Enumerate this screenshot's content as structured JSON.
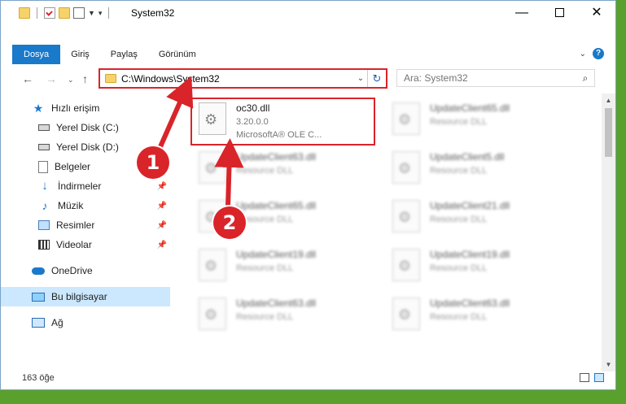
{
  "window": {
    "title": "System32",
    "controls": {
      "minimize": "—",
      "maximize": "",
      "close": "✕"
    }
  },
  "ribbon": {
    "tabs": [
      {
        "label": "Dosya",
        "active": true
      },
      {
        "label": "Giriş"
      },
      {
        "label": "Paylaş"
      },
      {
        "label": "Görünüm"
      }
    ],
    "help": "?"
  },
  "nav": {
    "back": "←",
    "forward": "→",
    "recent": "⌄",
    "up": "↑"
  },
  "address": {
    "path": "C:\\Windows\\System32"
  },
  "search": {
    "placeholder": "Ara: System32"
  },
  "sidebar": {
    "items": [
      {
        "label": "Hızlı erişim",
        "icon": "star-icon"
      },
      {
        "label": "Yerel Disk (C:)",
        "icon": "disk-icon"
      },
      {
        "label": "Yerel Disk (D:)",
        "icon": "disk-icon"
      },
      {
        "label": "Belgeler",
        "icon": "documents-icon"
      },
      {
        "label": "İndirmeler",
        "icon": "download-icon",
        "pinned": true
      },
      {
        "label": "Müzik",
        "icon": "music-icon",
        "pinned": true
      },
      {
        "label": "Resimler",
        "icon": "pictures-icon",
        "pinned": true
      },
      {
        "label": "Videolar",
        "icon": "video-icon",
        "pinned": true
      },
      {
        "label": "OneDrive",
        "icon": "cloud-icon"
      },
      {
        "label": "Bu bilgisayar",
        "icon": "computer-icon",
        "selected": true
      },
      {
        "label": "Ağ",
        "icon": "network-icon"
      }
    ]
  },
  "files": [
    {
      "name": "oc30.dll",
      "line2": "3.20.0.0",
      "line3": "MicrosoftA® OLE C...",
      "blurred": false
    },
    {
      "name": "UpdateClient65.dll",
      "line2": "Resource DLL",
      "blurred": true
    },
    {
      "name": "UpdateClient63.dll",
      "line2": "Resource DLL",
      "blurred": true
    },
    {
      "name": "UpdateClient5.dll",
      "line2": "Resource DLL",
      "blurred": true
    },
    {
      "name": "UpdateClient65.dll",
      "line2": "Resource DLL",
      "blurred": true
    },
    {
      "name": "UpdateClient21.dll",
      "line2": "Resource DLL",
      "blurred": true
    },
    {
      "name": "UpdateClient19.dll",
      "line2": "Resource DLL",
      "blurred": true
    },
    {
      "name": "UpdateClient19.dll",
      "line2": "Resource DLL",
      "blurred": true
    },
    {
      "name": "UpdateClient63.dll",
      "line2": "Resource DLL",
      "blurred": true
    },
    {
      "name": "UpdateClient63.dll",
      "line2": "Resource DLL",
      "blurred": true
    }
  ],
  "status": {
    "count": "163 öğe"
  },
  "annotations": {
    "step1": "1",
    "step2": "2",
    "color": "#d9242a"
  },
  "colors": {
    "accent": "#1979ca",
    "highlight": "#d9242a",
    "selected": "#cce8ff"
  }
}
